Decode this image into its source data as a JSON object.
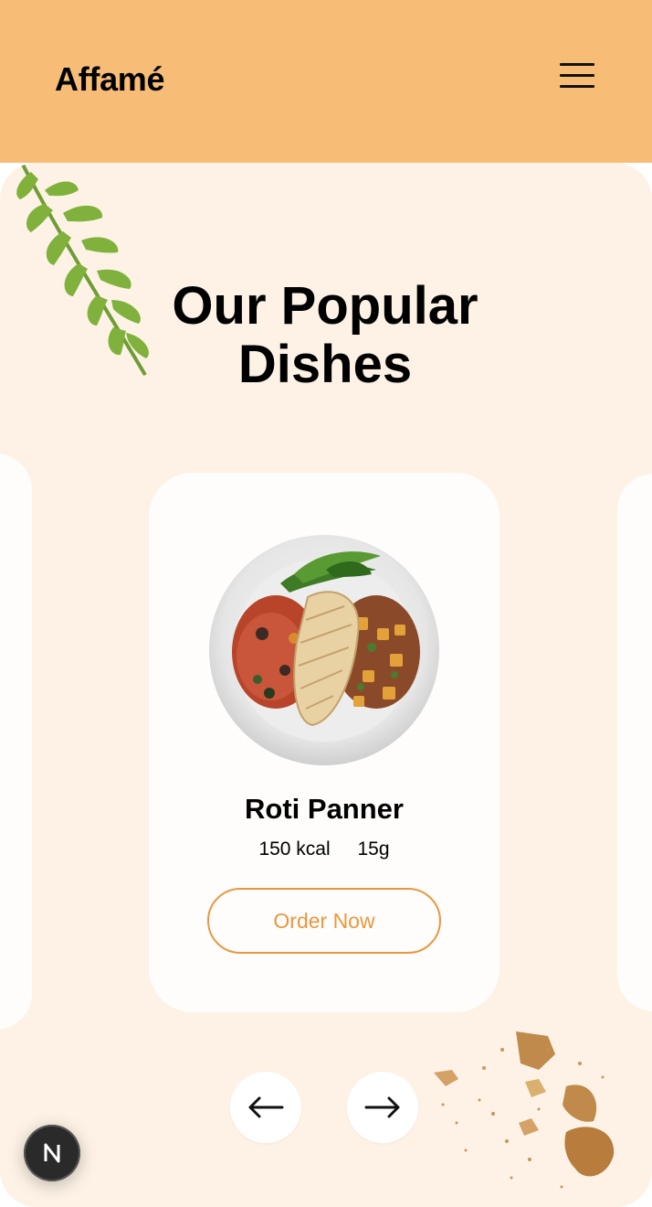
{
  "header": {
    "logo": "Affamé",
    "menu_icon": "hamburger-menu-icon"
  },
  "section": {
    "title_line1": "Our Popular",
    "title_line2": "Dishes"
  },
  "carousel": {
    "active_dish": {
      "name": "Roti Panner",
      "calories": "150 kcal",
      "protein": "15g",
      "order_label": "Order Now"
    },
    "prev_icon": "arrow-left-icon",
    "next_icon": "arrow-right-icon"
  },
  "colors": {
    "header_bg": "#f7bc76",
    "page_bg": "#fdf2e5",
    "card_bg": "#fffdfc",
    "accent": "#e9973f"
  },
  "badge": {
    "letter": "N",
    "icon": "nextjs-badge-icon"
  }
}
